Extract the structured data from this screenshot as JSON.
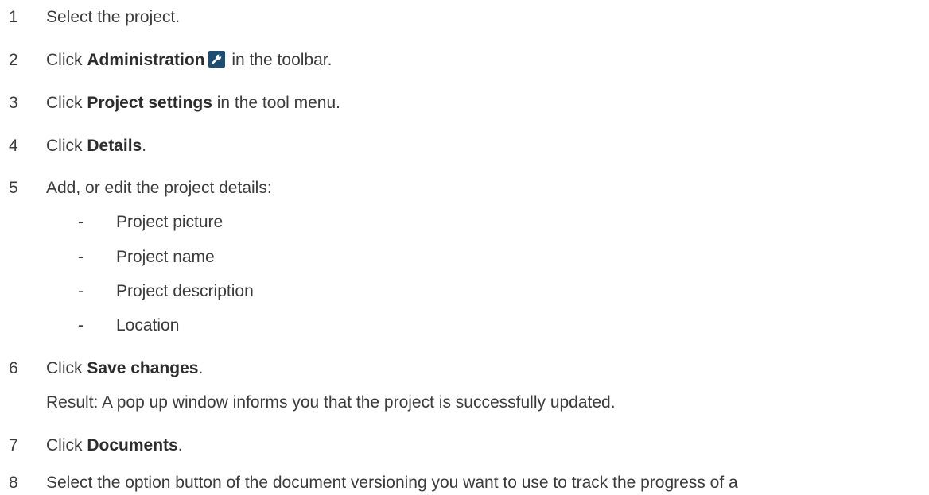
{
  "steps": [
    {
      "num": "1",
      "text": "Select the project."
    },
    {
      "num": "2",
      "pre": "Click ",
      "bold": "Administration",
      "post": " in the toolbar.",
      "icon": "wrench-icon"
    },
    {
      "num": "3",
      "pre": "Click ",
      "bold": "Project settings",
      "post": " in the tool menu."
    },
    {
      "num": "4",
      "pre": "Click ",
      "bold": "Details",
      "post": "."
    },
    {
      "num": "5",
      "text": "Add, or edit the project details:"
    },
    {
      "num": "6",
      "pre": "Click ",
      "bold": "Save changes",
      "post": "."
    },
    {
      "num": "7",
      "pre": "Click ",
      "bold": "Documents",
      "post": "."
    },
    {
      "num": "8",
      "text": "Select the option button of the document versioning you want to use to track the progress of a"
    }
  ],
  "sub_items": [
    "Project picture",
    "Project name",
    "Project description",
    "Location"
  ],
  "sub_bullet": "-",
  "result_text": "Result: A pop up window informs you that the project is successfully updated.",
  "colors": {
    "text": "#3b3b3b",
    "icon_background": "#1e4d72",
    "icon_glyph": "#ffffff"
  }
}
